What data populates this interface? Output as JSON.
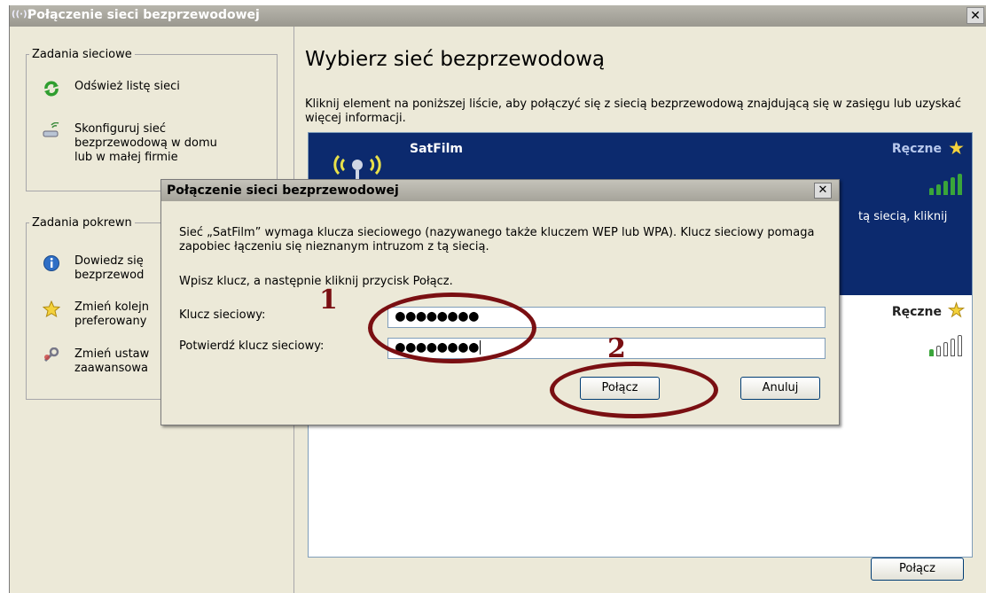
{
  "main_window": {
    "title": "Połączenie sieci bezprzewodowej",
    "close_glyph": "✕"
  },
  "left_pane": {
    "network_tasks": {
      "title": "Zadania sieciowe",
      "items": [
        {
          "label": "Odśwież listę sieci",
          "icon": "refresh-icon"
        },
        {
          "label": "Skonfiguruj sieć\nbezprzewodową w domu\nlub w małej firmie",
          "icon": "wireless-setup-icon"
        }
      ]
    },
    "related_tasks": {
      "title": "Zadania pokrewn",
      "items": [
        {
          "label": "Dowiedz się\nbezprzewod",
          "icon": "info-icon"
        },
        {
          "label": "Zmień kolejn\npreferowany",
          "icon": "star-icon"
        },
        {
          "label": "Zmień ustaw\nzaawansowa",
          "icon": "settings-icon"
        }
      ]
    }
  },
  "right_pane": {
    "title": "Wybierz sieć bezprzewodową",
    "description": "Kliknij element na poniższej liście, aby połączyć się z siecią bezprzewodową znajdującą się w zasięgu lub uzyskać więcej informacji.",
    "networks": [
      {
        "name": "SatFilm",
        "mode": "Ręczne",
        "signal_bars": 5,
        "selected": true,
        "desc_fragment": "tą siecią, kliknij"
      },
      {
        "name": "",
        "mode": "Ręczne",
        "signal_bars": 1,
        "selected": false
      }
    ],
    "connect_button": "Połącz"
  },
  "dialog": {
    "title": "Połączenie sieci bezprzewodowej",
    "message": "Sieć „SatFilm” wymaga klucza sieciowego (nazywanego także kluczem WEP lub WPA). Klucz sieciowy pomaga zapobiec łączeniu się nieznanym intruzom z tą siecią.",
    "instruction": "Wpisz klucz, a następnie kliknij przycisk Połącz.",
    "key_label": "Klucz sieciowy:",
    "key_value": "●●●●●●●●",
    "confirm_label": "Potwierdź klucz sieciowy:",
    "confirm_value": "●●●●●●●●",
    "connect_button": "Połącz",
    "cancel_button": "Anuluj",
    "close_glyph": "✕"
  },
  "annotations": [
    "1",
    "2"
  ],
  "colors": {
    "selected_bg": "#0c2a6e",
    "signal_green": "#3aa53a",
    "annotation": "#7a0f12",
    "window_bg": "#ece9d8"
  }
}
